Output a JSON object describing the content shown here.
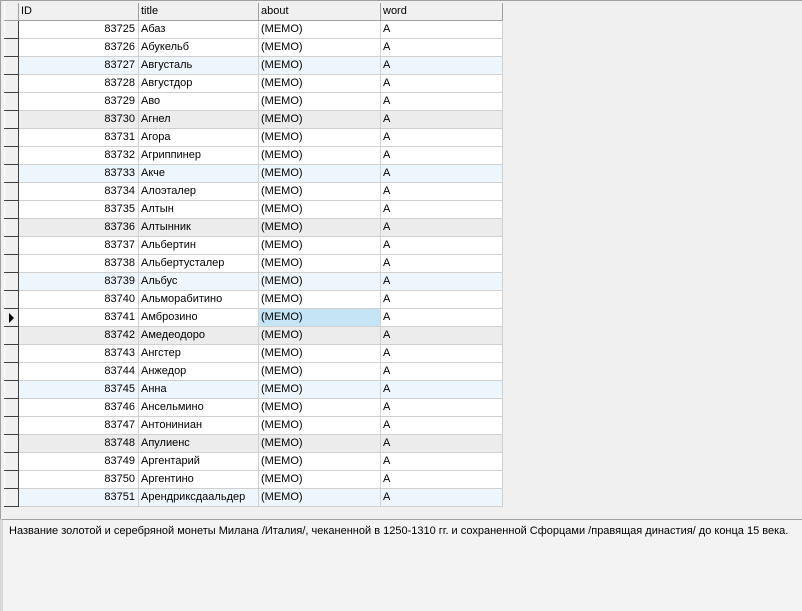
{
  "grid": {
    "columns": [
      "ID",
      "title",
      "about",
      "word"
    ],
    "selected_index": 16,
    "rows": [
      {
        "id": "83725",
        "title": "Абаз",
        "about": "(MEMO)",
        "word": "А"
      },
      {
        "id": "83726",
        "title": "Абукельб",
        "about": "(MEMO)",
        "word": "А"
      },
      {
        "id": "83727",
        "title": "Августаль",
        "about": "(MEMO)",
        "word": "А"
      },
      {
        "id": "83728",
        "title": "Августдор",
        "about": "(MEMO)",
        "word": "А"
      },
      {
        "id": "83729",
        "title": "Аво",
        "about": "(MEMO)",
        "word": "А"
      },
      {
        "id": "83730",
        "title": "Агнел",
        "about": "(MEMO)",
        "word": "А"
      },
      {
        "id": "83731",
        "title": "Агора",
        "about": "(MEMO)",
        "word": "А"
      },
      {
        "id": "83732",
        "title": "Агриппинер",
        "about": "(MEMO)",
        "word": "А"
      },
      {
        "id": "83733",
        "title": "Акче",
        "about": "(MEMO)",
        "word": "А"
      },
      {
        "id": "83734",
        "title": "Алоэталер",
        "about": "(MEMO)",
        "word": "А"
      },
      {
        "id": "83735",
        "title": "Алтын",
        "about": "(MEMO)",
        "word": "А"
      },
      {
        "id": "83736",
        "title": "Алтынник",
        "about": "(MEMO)",
        "word": "А"
      },
      {
        "id": "83737",
        "title": "Альбертин",
        "about": "(MEMO)",
        "word": "А"
      },
      {
        "id": "83738",
        "title": "Альбертусталер",
        "about": "(MEMO)",
        "word": "А"
      },
      {
        "id": "83739",
        "title": "Альбус",
        "about": "(MEMO)",
        "word": "А"
      },
      {
        "id": "83740",
        "title": "Альморабитино",
        "about": "(MEMO)",
        "word": "А"
      },
      {
        "id": "83741",
        "title": "Амброзино",
        "about": "(MEMO)",
        "word": "А"
      },
      {
        "id": "83742",
        "title": "Амедеодоро",
        "about": "(MEMO)",
        "word": "А"
      },
      {
        "id": "83743",
        "title": "Ангстер",
        "about": "(MEMO)",
        "word": "А"
      },
      {
        "id": "83744",
        "title": "Анжедор",
        "about": "(MEMO)",
        "word": "А"
      },
      {
        "id": "83745",
        "title": "Анна",
        "about": "(MEMO)",
        "word": "А"
      },
      {
        "id": "83746",
        "title": "Ансельмино",
        "about": "(MEMO)",
        "word": "А"
      },
      {
        "id": "83747",
        "title": "Антониниан",
        "about": "(MEMO)",
        "word": "А"
      },
      {
        "id": "83748",
        "title": "Апулиенс",
        "about": "(MEMO)",
        "word": "А"
      },
      {
        "id": "83749",
        "title": "Аргентарий",
        "about": "(MEMO)",
        "word": "А"
      },
      {
        "id": "83750",
        "title": "Аргентино",
        "about": "(MEMO)",
        "word": "А"
      },
      {
        "id": "83751",
        "title": "Арендриксдаальдер",
        "about": "(MEMO)",
        "word": "А"
      }
    ]
  },
  "memo": {
    "text": "Название золотой и серебряной монеты Милана /Италия/, чеканенной в 1250-1310 гг. и сохраненной Сфорцами /правящая династия/ до конца 15 века."
  },
  "colors": {
    "selected_cell": "#c5e4f5",
    "row_blue": "#eef6fd",
    "row_gray": "#ececec"
  }
}
